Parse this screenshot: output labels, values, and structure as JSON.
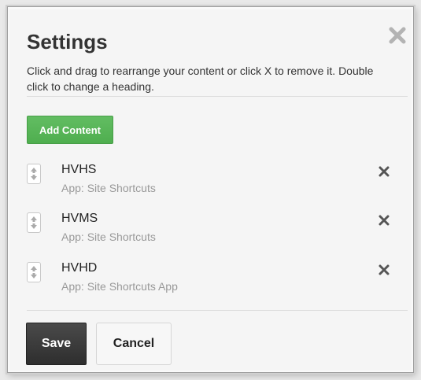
{
  "dialog": {
    "title": "Settings",
    "close_icon": "close-icon",
    "instructions": "Click and drag to rearrange your content or click X to remove it. Double click to change a heading."
  },
  "toolbar": {
    "add_content_label": "Add Content"
  },
  "items": [
    {
      "name": "HVHS",
      "subtitle": "App: Site Shortcuts"
    },
    {
      "name": "HVMS",
      "subtitle": "App: Site Shortcuts"
    },
    {
      "name": "HVHD",
      "subtitle": "App: Site Shortcuts App"
    }
  ],
  "footer": {
    "save_label": "Save",
    "cancel_label": "Cancel"
  },
  "colors": {
    "add_button": "#5cb85c",
    "save_button": "#333333",
    "subtitle_text": "#999999"
  }
}
